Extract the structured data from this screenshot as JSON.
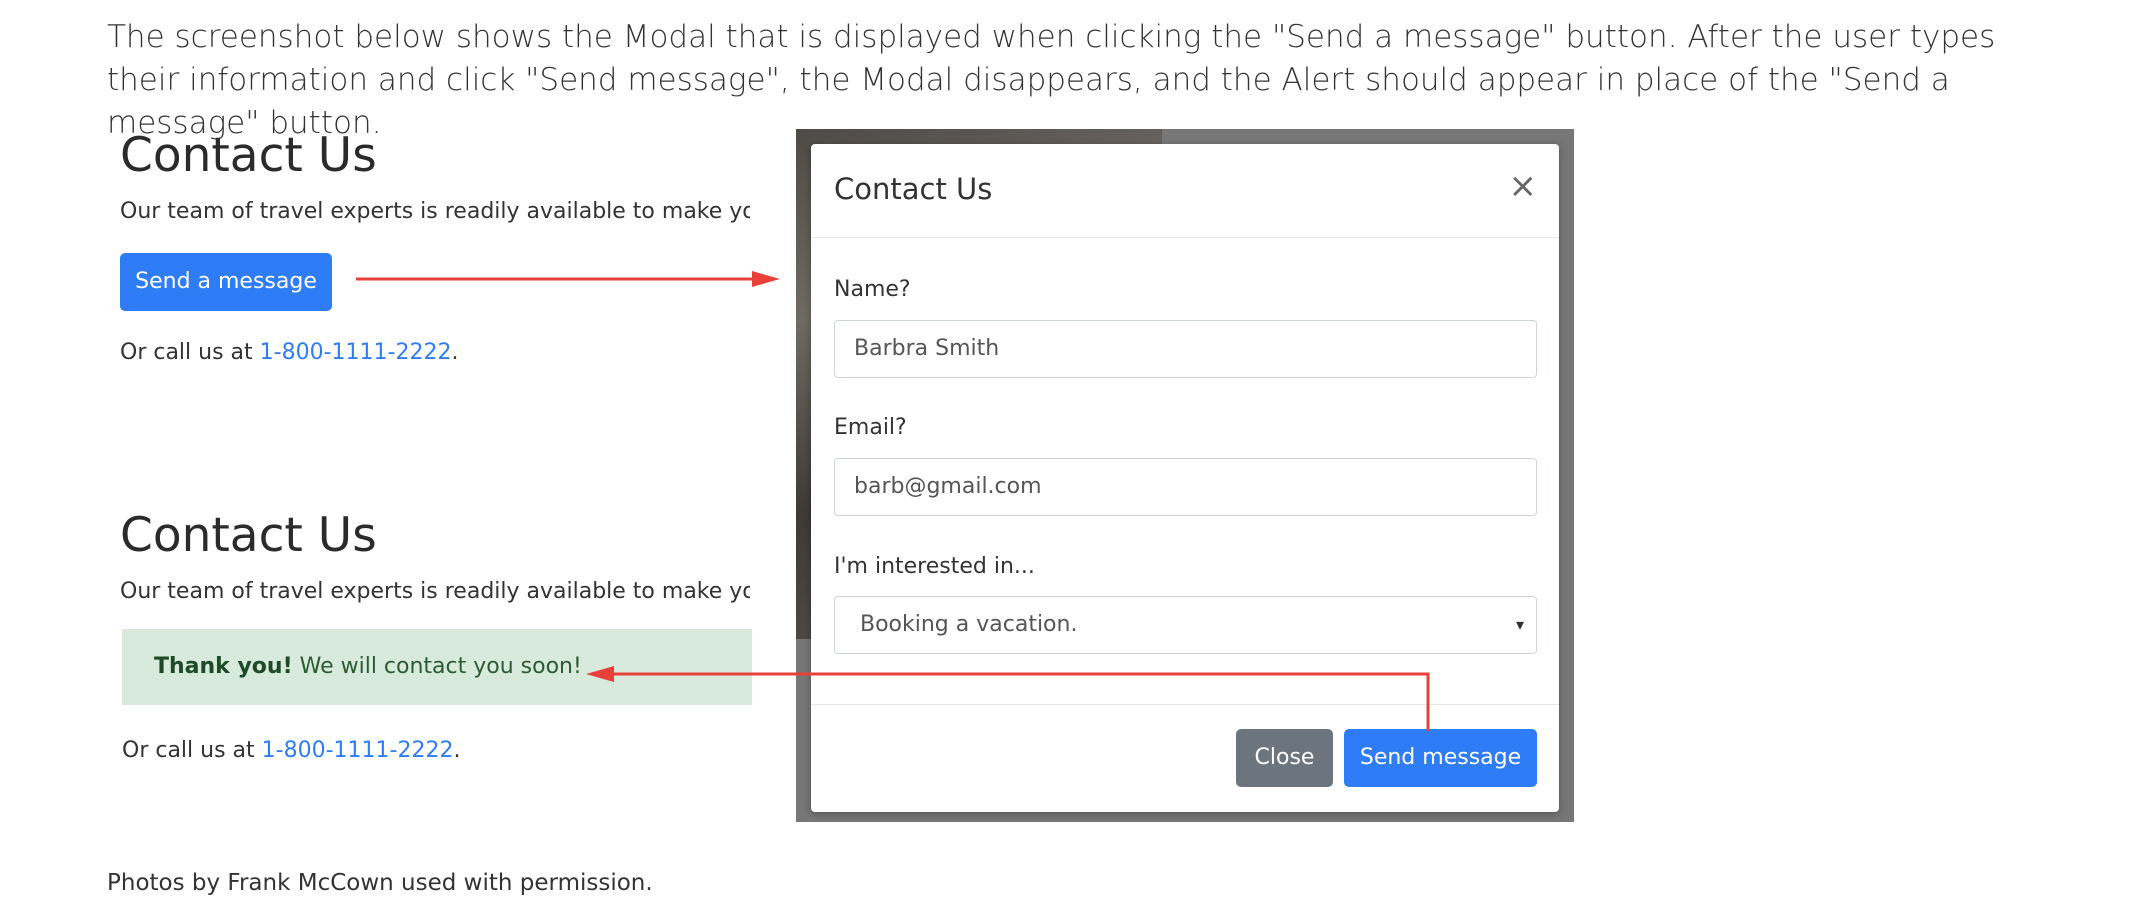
{
  "intro_text": "The screenshot below shows the Modal that is displayed when clicking the \"Send a message\" button. After the user types their information and click \"Send message\", the Modal disappears, and the Alert should appear in place of the \"Send a message\" button.",
  "before": {
    "heading": "Contact Us",
    "lead": "Our team of travel experts is readily available to make your",
    "send_button": "Send a message",
    "call_prefix": "Or call us at ",
    "phone": "1-800-1111-2222",
    "call_suffix": "."
  },
  "after": {
    "heading": "Contact Us",
    "lead": "Our team of travel experts is readily available to make your",
    "alert_strong": "Thank you!",
    "alert_text": " We will contact you soon!",
    "call_prefix": "Or call us at ",
    "phone": "1-800-1111-2222",
    "call_suffix": "."
  },
  "modal": {
    "title": "Contact Us",
    "close_glyph": "×",
    "name_label": "Name?",
    "name_value": "Barbra Smith",
    "email_label": "Email?",
    "email_value": "barb@gmail.com",
    "interest_label": "I'm interested in...",
    "interest_value": "Booking a vacation.",
    "caret": "▾",
    "close_button": "Close",
    "send_button": "Send message"
  },
  "caption": "Photos by Frank McCown used with permission.",
  "colors": {
    "primary": "#2f7df6",
    "arrow": "#e8413a",
    "alert_bg": "#d7eadb"
  }
}
